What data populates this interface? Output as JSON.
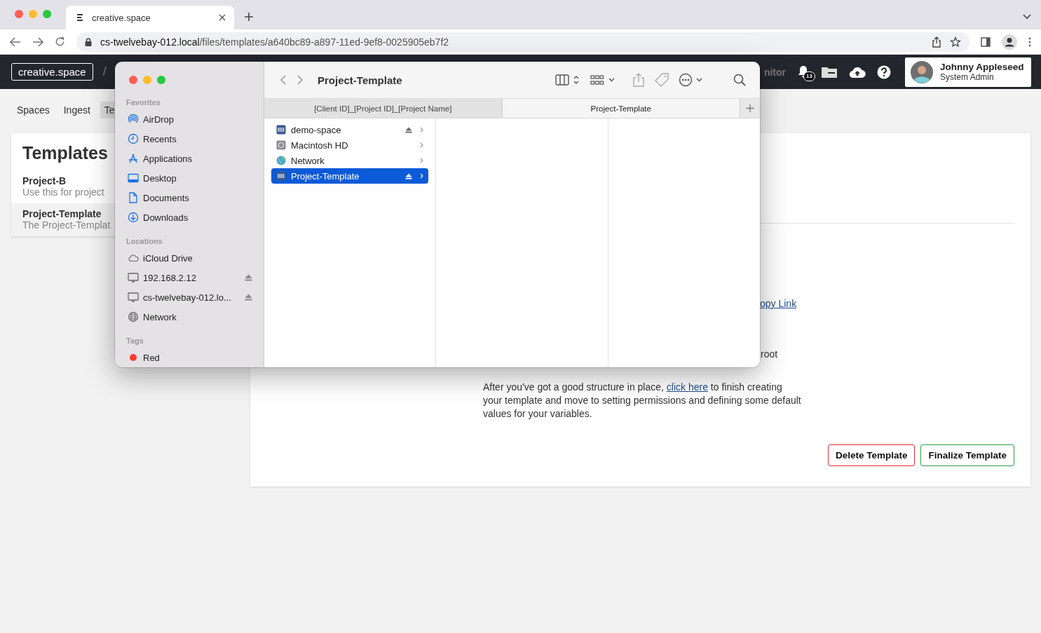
{
  "browser": {
    "tab_title": "creative.space",
    "url_host": "cs-twelvebay-012.local",
    "url_path": "/files/templates/a640bc89-a897-11ed-9ef8-0025905eb7f2"
  },
  "app_header": {
    "logo": "creative.space",
    "separator": "/",
    "nav_fragment": "nitor",
    "notification_count": "13",
    "user": {
      "name": "Johnny Appleseed",
      "role": "System Admin"
    }
  },
  "nav_tabs": [
    {
      "label": "Spaces",
      "selected": false
    },
    {
      "label": "Ingest",
      "selected": false
    },
    {
      "label": "Te",
      "selected": true
    }
  ],
  "templates_panel": {
    "title": "Templates",
    "items": [
      {
        "name": "Project-B",
        "description": "Use this for project",
        "selected": false
      },
      {
        "name": "Project-Template",
        "description": "The Project-Templat",
        "selected": true
      }
    ]
  },
  "main_card": {
    "link_fragment": "opy Link",
    "text_fragment": "root",
    "paragraph": {
      "before": "After you've got a good structure in place, ",
      "link": "click here",
      "after": " to finish creating your template and move to setting permissions and defining some default values for your variables."
    },
    "buttons": [
      {
        "label": "Delete Template",
        "kind": "danger"
      },
      {
        "label": "Finalize Template",
        "kind": "confirm"
      }
    ]
  },
  "finder": {
    "title": "Project-Template",
    "sections": [
      {
        "heading": "Favorites",
        "items": [
          {
            "label": "AirDrop",
            "kind": "airdrop",
            "eject": false
          },
          {
            "label": "Recents",
            "kind": "clock",
            "eject": false
          },
          {
            "label": "Applications",
            "kind": "apps",
            "eject": false
          },
          {
            "label": "Desktop",
            "kind": "desktop",
            "eject": false
          },
          {
            "label": "Documents",
            "kind": "document",
            "eject": false
          },
          {
            "label": "Downloads",
            "kind": "download",
            "eject": false
          }
        ]
      },
      {
        "heading": "Locations",
        "items": [
          {
            "label": "iCloud Drive",
            "kind": "cloud",
            "eject": false
          },
          {
            "label": "192.168.2.12",
            "kind": "computer",
            "eject": true
          },
          {
            "label": "cs-twelvebay-012.lo...",
            "kind": "computer",
            "eject": true
          },
          {
            "label": "Network",
            "kind": "globe",
            "eject": false
          }
        ]
      },
      {
        "heading": "Tags",
        "items": [
          {
            "label": "Red",
            "kind": "tag",
            "color": "#ff3b30",
            "eject": false
          }
        ]
      }
    ],
    "tabs": [
      {
        "label": "[Client ID]_[Project ID]_[Project Name]",
        "selected": false
      },
      {
        "label": "Project-Template",
        "selected": true
      }
    ],
    "column_items": [
      {
        "name": "demo-space",
        "kind": "server",
        "eject": true,
        "selected": false
      },
      {
        "name": "Macintosh HD",
        "kind": "disk",
        "eject": false,
        "selected": false
      },
      {
        "name": "Network",
        "kind": "network",
        "eject": false,
        "selected": false
      },
      {
        "name": "Project-Template",
        "kind": "server",
        "eject": true,
        "selected": true
      }
    ]
  }
}
